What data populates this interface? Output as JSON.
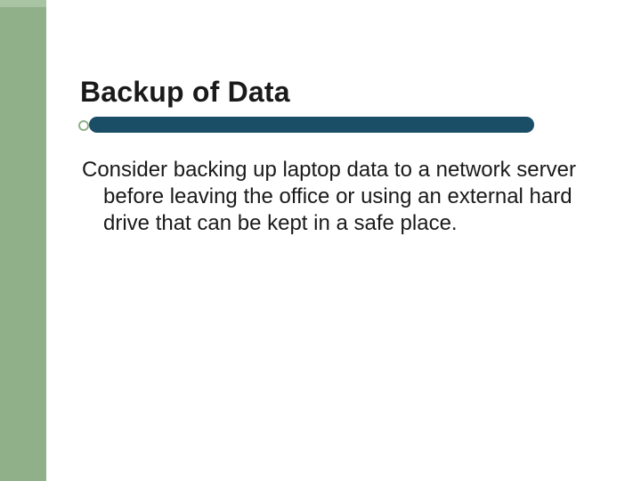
{
  "slide": {
    "title": "Backup of Data",
    "body": "Consider backing up laptop data to a network server before leaving the office or using an external hard drive that can be kept in a safe place."
  },
  "colors": {
    "sidebar": "#8fb089",
    "underline": "#1a4d66",
    "text": "#1a1a1a"
  }
}
